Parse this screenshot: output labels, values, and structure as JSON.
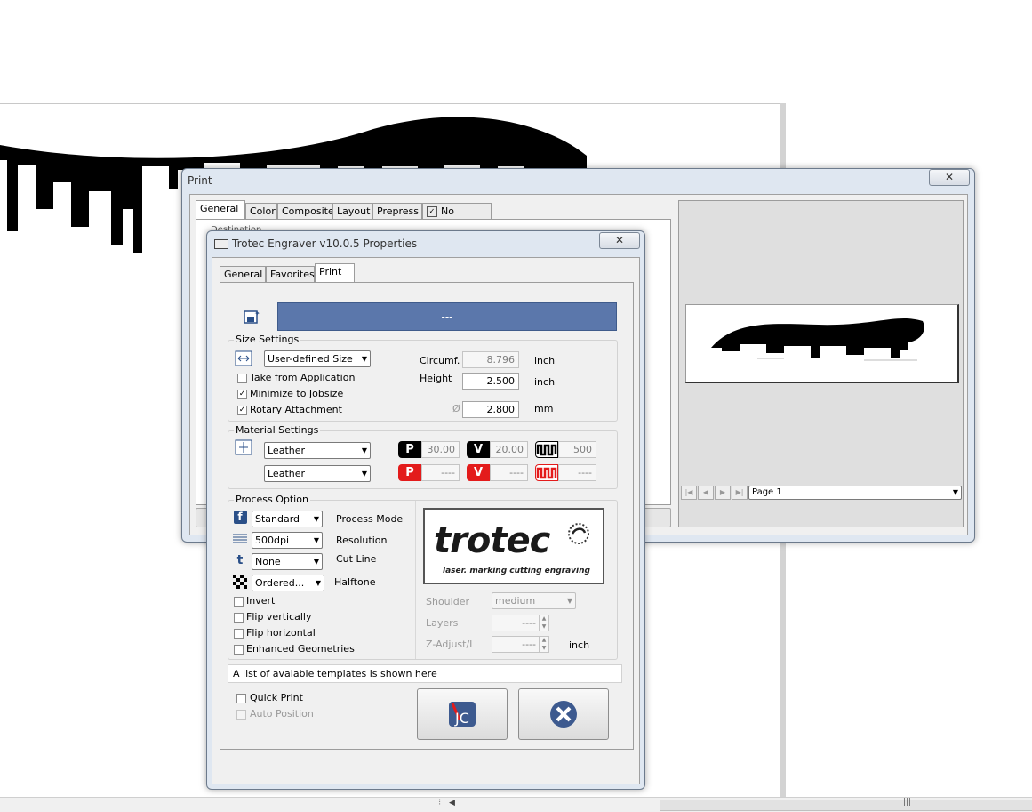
{
  "print_dialog": {
    "title": "Print",
    "close": "✕",
    "tabs": [
      "General",
      "Color",
      "Composite",
      "Layout",
      "Prepress",
      "No Issues"
    ],
    "destination_label": "Destination",
    "preview_page": "Page 1"
  },
  "props_dialog": {
    "title": "Trotec Engraver v10.0.5 Properties",
    "close": "✕",
    "tabs": [
      "General",
      "Favorites",
      "Print"
    ],
    "template_bar": "---",
    "size_settings": {
      "title": "Size Settings",
      "size_select": "User-defined Size",
      "take_from_application": "Take from Application",
      "minimize_to_jobsize": "Minimize to Jobsize",
      "rotary_attachment": "Rotary Attachment",
      "circumf_label": "Circumf.",
      "circumf_value": "8.796",
      "circumf_unit": "inch",
      "height_label": "Height",
      "height_value": "2.500",
      "height_unit": "inch",
      "diameter_symbol": "Ø",
      "diameter_value": "2.800",
      "diameter_unit": "mm"
    },
    "material_settings": {
      "title": "Material Settings",
      "material_1": "Leather",
      "material_2": "Leather",
      "p_label": "P",
      "v_label": "V",
      "p1": "30.00",
      "v1": "20.00",
      "f1": "500",
      "p2": "----",
      "v2": "----",
      "f2": "----"
    },
    "process_option": {
      "title": "Process Option",
      "process_mode_value": "Standard",
      "process_mode_label": "Process Mode",
      "resolution_value": "500dpi",
      "resolution_label": "Resolution",
      "cut_line_value": "None",
      "cut_line_label": "Cut Line",
      "halftone_value": "Ordered...",
      "halftone_label": "Halftone",
      "invert": "Invert",
      "flip_vertically": "Flip vertically",
      "flip_horizontal": "Flip horizontal",
      "enhanced_geometries": "Enhanced Geometries",
      "shoulder_label": "Shoulder",
      "shoulder_value": "medium",
      "layers_label": "Layers",
      "layers_value": "----",
      "zadjust_label": "Z-Adjust/L",
      "zadjust_value": "----",
      "zadjust_unit": "inch",
      "logo_text": "trotec",
      "logo_tagline": "laser. marking cutting engraving"
    },
    "templates_info": "A list of avaiable templates is shown here",
    "quick_print": "Quick Print",
    "auto_position": "Auto Position"
  },
  "colors": {
    "template_bar": "#5b77ab",
    "p_badge_black": "#000000",
    "p_badge_red": "#e31b1b",
    "cancel_icon": "#3d5a8f"
  }
}
